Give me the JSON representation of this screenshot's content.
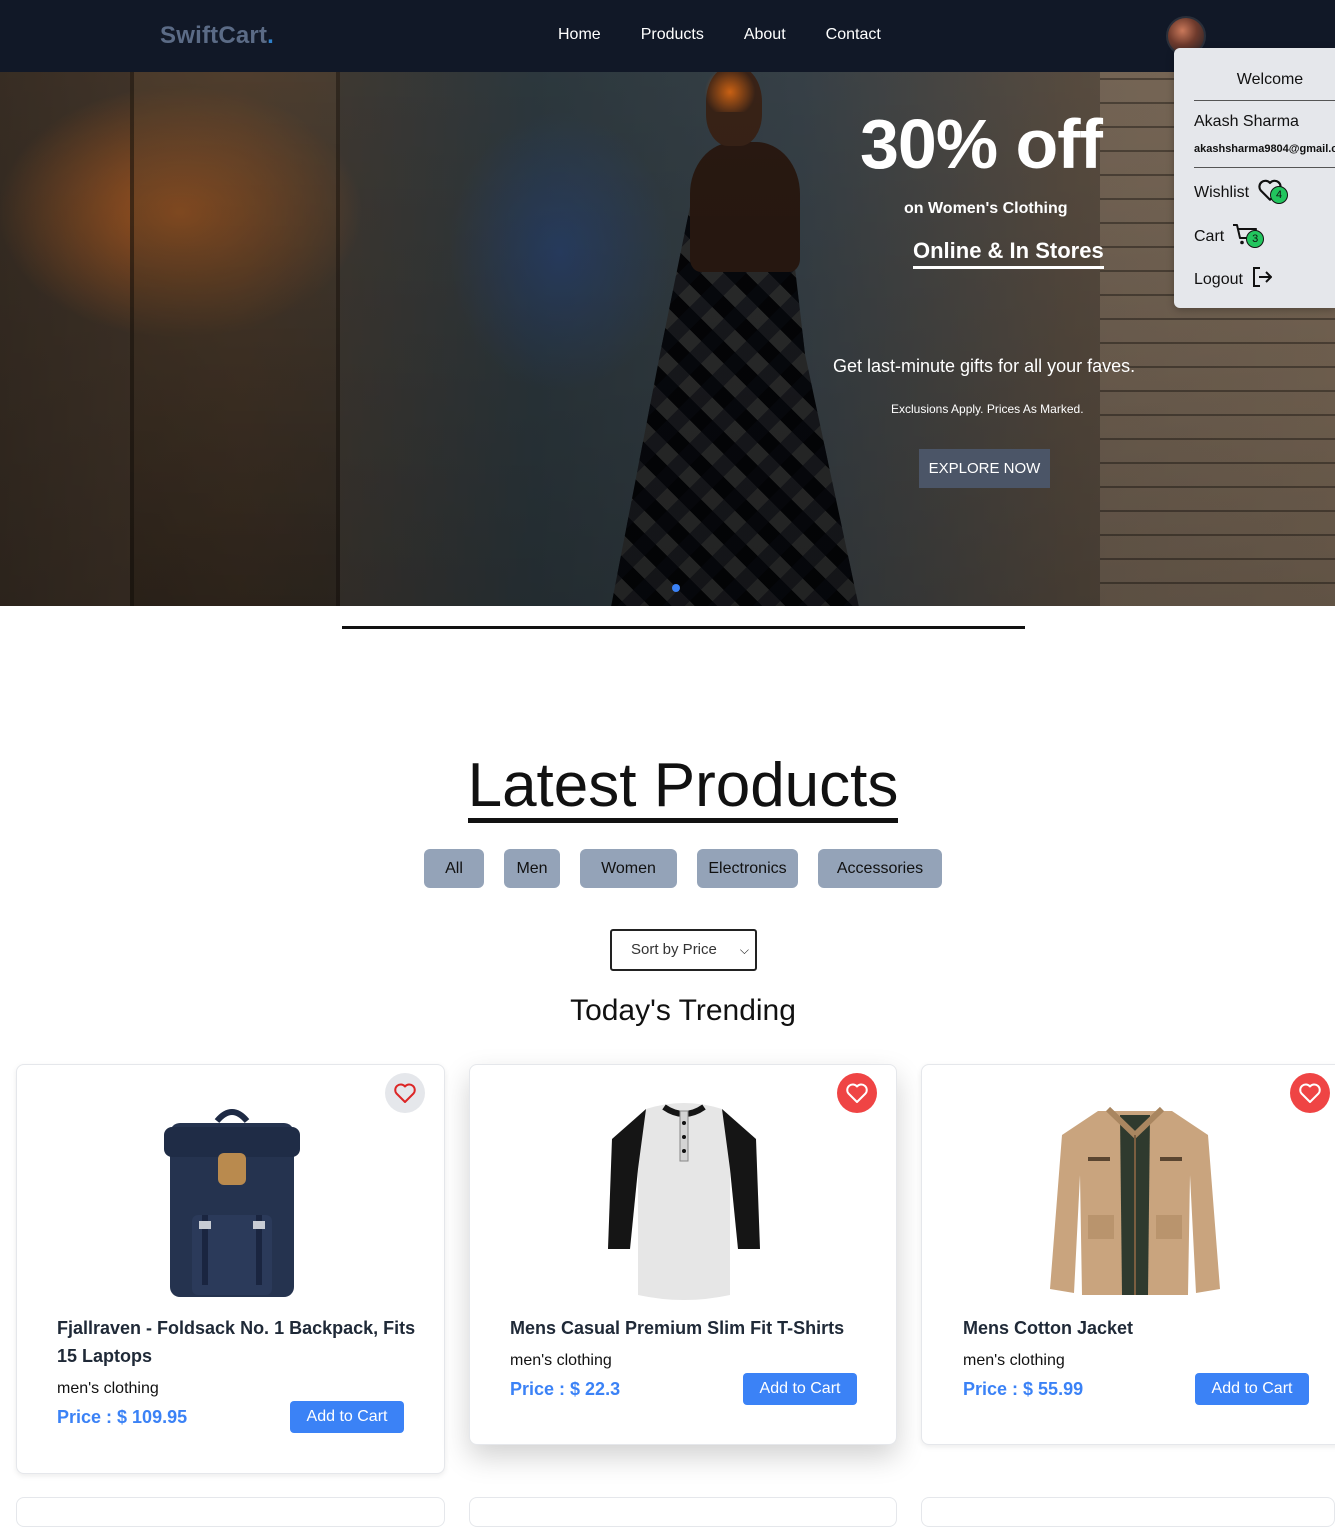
{
  "navbar": {
    "logo": "SwiftCart",
    "logo_dot": ".",
    "links": [
      "Home",
      "Products",
      "About",
      "Contact"
    ]
  },
  "dropdown": {
    "welcome": "Welcome",
    "name": "Akash Sharma",
    "email": "akashsharma9804@gmail.c",
    "wishlist_label": "Wishlist",
    "wishlist_count": "4",
    "cart_label": "Cart",
    "cart_count": "3",
    "logout_label": "Logout"
  },
  "hero": {
    "headline": "30% off",
    "subline": "on Women's Clothing",
    "stores": "Online & In Stores",
    "gifts": "Get last-minute gifts for all your faves.",
    "exclusions": "Exclusions Apply. Prices As Marked.",
    "button": "EXPLORE NOW"
  },
  "latest": {
    "title": "Latest Products",
    "filters": [
      "All",
      "Men",
      "Women",
      "Electronics",
      "Accessories"
    ],
    "sort_label": "Sort by Price",
    "trending": "Today's Trending"
  },
  "products": [
    {
      "title": "Fjallraven - Foldsack No. 1 Backpack, Fits 15 Laptops",
      "category": "men's clothing",
      "price": "Price : $ 109.95",
      "button": "Add to Cart",
      "wishlisted": false,
      "image": "backpack"
    },
    {
      "title": "Mens Casual Premium Slim Fit T-Shirts",
      "category": "men's clothing",
      "price": "Price : $ 22.3",
      "button": "Add to Cart",
      "wishlisted": true,
      "image": "t-shirt"
    },
    {
      "title": "Mens Cotton Jacket",
      "category": "men's clothing",
      "price": "Price : $ 55.99",
      "button": "Add to Cart",
      "wishlisted": true,
      "image": "jacket"
    }
  ],
  "colors": {
    "navbar_bg": "#111827",
    "accent_blue": "#3b82f6",
    "filter_bg": "#94a3b8",
    "heart_active": "#ef4444",
    "badge_green": "#22c55e"
  }
}
